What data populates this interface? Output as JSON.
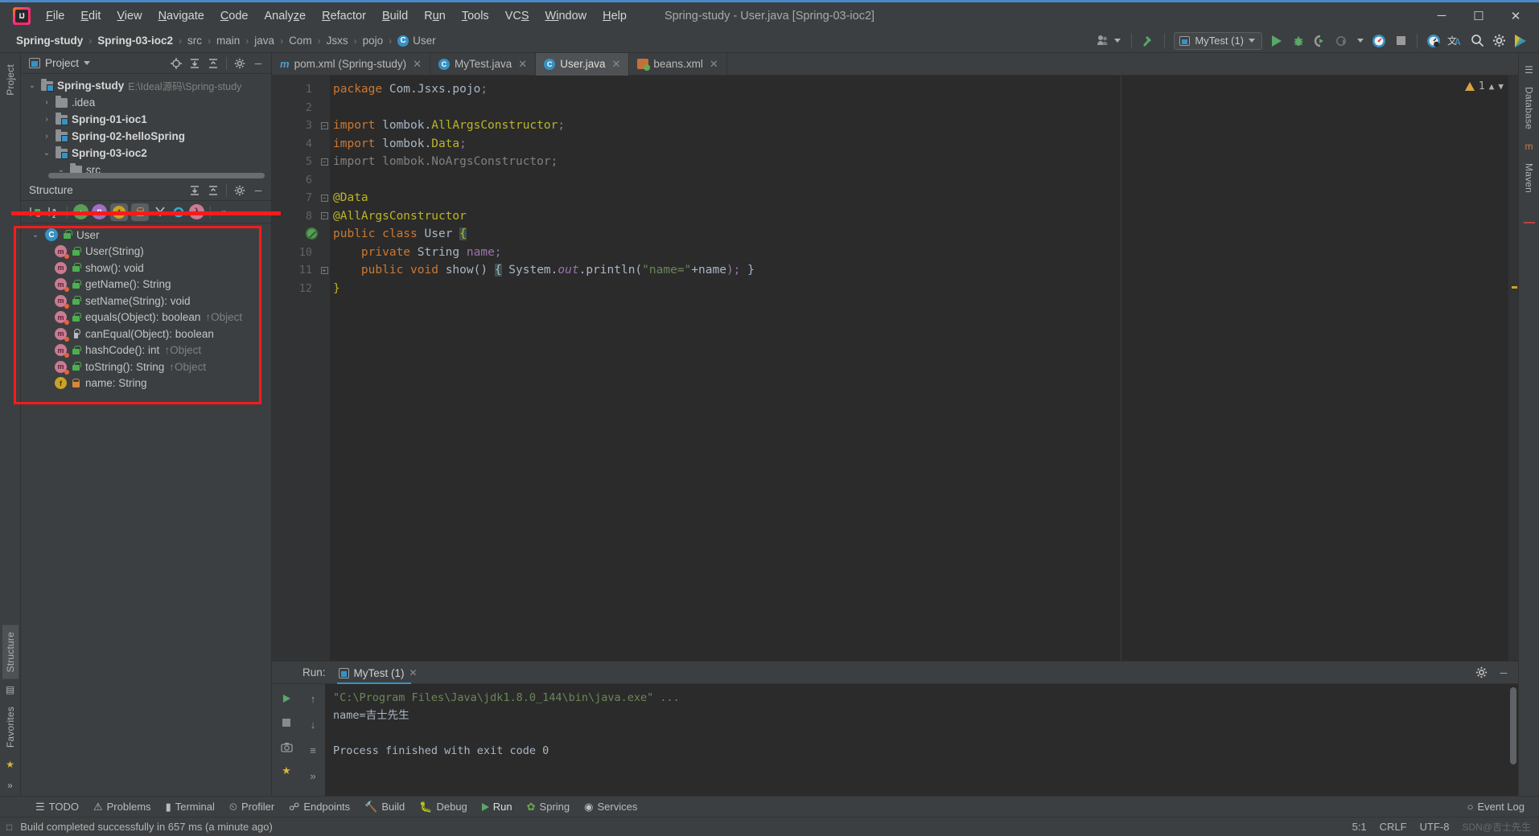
{
  "window": {
    "title": "Spring-study - User.java [Spring-03-ioc2]",
    "logo": "intellij-idea-logo",
    "controls": {
      "minimize": "—",
      "maximize": "☐",
      "close": "✕"
    }
  },
  "menubar": {
    "items": [
      "File",
      "Edit",
      "View",
      "Navigate",
      "Code",
      "Analyze",
      "Refactor",
      "Build",
      "Run",
      "Tools",
      "VCS",
      "Window",
      "Help"
    ]
  },
  "breadcrumb": {
    "items": [
      {
        "label": "Spring-study",
        "bold": true
      },
      {
        "label": "Spring-03-ioc2",
        "bold": true
      },
      {
        "label": "src",
        "bold": false
      },
      {
        "label": "main",
        "bold": false
      },
      {
        "label": "java",
        "bold": false
      },
      {
        "label": "Com",
        "bold": false
      },
      {
        "label": "Jsxs",
        "bold": false
      },
      {
        "label": "pojo",
        "bold": false
      },
      {
        "label": "User",
        "bold": false,
        "icon": "class-badge"
      }
    ],
    "separator": "›"
  },
  "toolbar": {
    "account_icon": "user-account-icon",
    "build_icon": "hammer-icon",
    "run_config": {
      "label": "MyTest (1)",
      "icon": "run-config-icon",
      "caret": "▾"
    },
    "run_icon": "run-play-icon",
    "debug_icon": "debug-bug-icon",
    "run_coverage_icon": "run-with-coverage-icon",
    "profiler_icon": "profiler-icon",
    "stop_icon": "stop-icon",
    "updates_icon": "check-updates-icon",
    "translate_icon": "translate-icon",
    "search_icon": "search-everywhere-icon",
    "settings_icon": "settings-gear-icon",
    "ide_icon": "ide-feature-icon"
  },
  "left_strip": {
    "tabs": [
      "Project",
      "Structure",
      "Favorites"
    ],
    "more": "»"
  },
  "right_strip": {
    "tabs": [
      "Database",
      "Maven"
    ]
  },
  "project_panel": {
    "title": "Project",
    "title_caret": "▾",
    "icon": "project-view-icon",
    "tools": [
      "locate-icon",
      "expand-all-icon",
      "collapse-all-icon",
      "settings-gear-icon",
      "hide-icon"
    ],
    "tree": [
      {
        "label": "Spring-study",
        "path": "E:\\Ideal源码\\Spring-study",
        "indent": 0,
        "arrow": "⌄",
        "bold": true,
        "module": true
      },
      {
        "label": ".idea",
        "path": "",
        "indent": 1,
        "arrow": "›",
        "bold": false,
        "module": false
      },
      {
        "label": "Spring-01-ioc1",
        "path": "",
        "indent": 1,
        "arrow": "›",
        "bold": true,
        "module": true
      },
      {
        "label": "Spring-02-helloSpring",
        "path": "",
        "indent": 1,
        "arrow": "›",
        "bold": true,
        "module": true
      },
      {
        "label": "Spring-03-ioc2",
        "path": "",
        "indent": 1,
        "arrow": "⌄",
        "bold": true,
        "module": true
      },
      {
        "label": "src",
        "path": "",
        "indent": 2,
        "arrow": "⌄",
        "bold": false,
        "module": false
      }
    ]
  },
  "structure_panel": {
    "title": "Structure",
    "tools": [
      "expand-all-icon",
      "collapse-all-icon",
      "settings-gear-icon",
      "hide-icon"
    ],
    "filter_icons": [
      "sort-by-visibility-icon",
      "sort-alphabetically-icon",
      "show-inherited-icon",
      "show-non-public-icon",
      "show-fields-icon",
      "show-properties-icon",
      "show-anonymous-icon",
      "group-icon",
      "lambda-icon"
    ],
    "tree": [
      {
        "label": "User",
        "kind": "class",
        "vis": "pub",
        "indent": 0,
        "arrow": "⌄",
        "sup": ""
      },
      {
        "label": "User(String)",
        "kind": "ctor",
        "vis": "pub",
        "indent": 1,
        "arrow": "",
        "sup": ""
      },
      {
        "label": "show(): void",
        "kind": "method",
        "vis": "pub",
        "indent": 1,
        "arrow": "",
        "sup": ""
      },
      {
        "label": "getName(): String",
        "kind": "ctor",
        "vis": "pub",
        "indent": 1,
        "arrow": "",
        "sup": ""
      },
      {
        "label": "setName(String): void",
        "kind": "ctor",
        "vis": "pub",
        "indent": 1,
        "arrow": "",
        "sup": ""
      },
      {
        "label": "equals(Object): boolean",
        "kind": "ctor",
        "vis": "pub",
        "indent": 1,
        "arrow": "",
        "sup": "↑Object"
      },
      {
        "label": "canEqual(Object): boolean",
        "kind": "ctor",
        "vis": "pkg",
        "indent": 1,
        "arrow": "",
        "sup": ""
      },
      {
        "label": "hashCode(): int",
        "kind": "ctor",
        "vis": "pub",
        "indent": 1,
        "arrow": "",
        "sup": "↑Object"
      },
      {
        "label": "toString(): String",
        "kind": "ctor",
        "vis": "pub",
        "indent": 1,
        "arrow": "",
        "sup": "↑Object"
      },
      {
        "label": "name: String",
        "kind": "field",
        "vis": "priv",
        "indent": 1,
        "arrow": "",
        "sup": ""
      }
    ],
    "annotation_color": "#f81b1b"
  },
  "editor": {
    "tabs": [
      {
        "label": "pom.xml (Spring-study)",
        "icon": "maven-icon",
        "active": false,
        "close": "✕"
      },
      {
        "label": "MyTest.java",
        "icon": "class-icon",
        "active": false,
        "close": "✕"
      },
      {
        "label": "User.java",
        "icon": "class-icon",
        "active": true,
        "close": "✕"
      },
      {
        "label": "beans.xml",
        "icon": "spring-xml-icon",
        "active": false,
        "close": "✕"
      }
    ],
    "line_numbers": [
      "1",
      "2",
      "3",
      "4",
      "5",
      "6",
      "7",
      "8",
      "9",
      "10",
      "11",
      "12"
    ],
    "lines": [
      {
        "n": 1,
        "tokens": [
          {
            "t": "package ",
            "c": "kw"
          },
          {
            "t": "Com.Jsxs.pojo",
            "c": "plain"
          },
          {
            "t": ";",
            "c": "fld"
          }
        ]
      },
      {
        "n": 2,
        "tokens": []
      },
      {
        "n": 3,
        "tokens": [
          {
            "t": "import ",
            "c": "kw"
          },
          {
            "t": "lombok.",
            "c": "plain"
          },
          {
            "t": "AllArgsConstructor",
            "c": "anno"
          },
          {
            "t": ";",
            "c": "fld"
          }
        ]
      },
      {
        "n": 4,
        "tokens": [
          {
            "t": "import ",
            "c": "kw"
          },
          {
            "t": "lombok.",
            "c": "plain"
          },
          {
            "t": "Data",
            "c": "anno"
          },
          {
            "t": ";",
            "c": "fld"
          }
        ]
      },
      {
        "n": 5,
        "tokens": [
          {
            "t": "import lombok.NoArgsConstructor;",
            "c": "gray"
          }
        ]
      },
      {
        "n": 6,
        "tokens": []
      },
      {
        "n": 7,
        "tokens": [
          {
            "t": "@Data",
            "c": "anno"
          }
        ]
      },
      {
        "n": 8,
        "tokens": [
          {
            "t": "@AllArgsConstructor",
            "c": "anno"
          }
        ]
      },
      {
        "n": 9,
        "tokens": [
          {
            "t": "public class ",
            "c": "kw"
          },
          {
            "t": "User ",
            "c": "cls"
          },
          {
            "t": "{",
            "c": "brace"
          }
        ]
      },
      {
        "n": 10,
        "tokens": [
          {
            "t": "    private ",
            "c": "kw"
          },
          {
            "t": "String ",
            "c": "cls"
          },
          {
            "t": "name",
            "c": "fld"
          },
          {
            "t": ";",
            "c": "fld"
          }
        ]
      },
      {
        "n": 11,
        "tokens": [
          {
            "t": "    public void ",
            "c": "kw"
          },
          {
            "t": "show",
            "c": "cls"
          },
          {
            "t": "() ",
            "c": "plain"
          },
          {
            "t": "{",
            "c": "bracehl"
          },
          {
            "t": " System.",
            "c": "plain"
          },
          {
            "t": "out",
            "c": "fldital"
          },
          {
            "t": ".println(",
            "c": "plain"
          },
          {
            "t": "\"name=\"",
            "c": "str"
          },
          {
            "t": "+name",
            "c": "plain"
          },
          {
            "t": "); }",
            "c": "plain"
          }
        ]
      },
      {
        "n": 12,
        "tokens": [
          {
            "t": "}",
            "c": "cls"
          }
        ]
      }
    ],
    "inspection": {
      "count": "1",
      "icon": "warning-triangle-icon",
      "up": "⌃",
      "down": "⌄"
    },
    "run_gutter_marker": "run-test-marker"
  },
  "run_panel": {
    "label": "Run:",
    "tab": {
      "label": "MyTest (1)",
      "icon": "test-run-icon",
      "close": "✕"
    },
    "settings_icon": "settings-gear-icon",
    "hide_icon": "hide-icon",
    "side_buttons": [
      "rerun-icon",
      "scroll-up-icon",
      "stop-icon",
      "scroll-down-icon",
      "print-icon",
      "soft-wrap-icon",
      "camera-icon",
      "pin-icon"
    ],
    "console": [
      {
        "text": "\"C:\\Program Files\\Java\\jdk1.8.0_144\\bin\\java.exe\" ...",
        "kind": "cmd"
      },
      {
        "text": "name=吉士先生",
        "kind": "out"
      },
      {
        "text": "",
        "kind": "out"
      },
      {
        "text": "Process finished with exit code 0",
        "kind": "out"
      }
    ]
  },
  "tool_tabs": {
    "items": [
      {
        "label": "TODO",
        "icon": "todo-icon"
      },
      {
        "label": "Problems",
        "icon": "problems-icon"
      },
      {
        "label": "Terminal",
        "icon": "terminal-icon"
      },
      {
        "label": "Profiler",
        "icon": "profiler-icon"
      },
      {
        "label": "Endpoints",
        "icon": "endpoints-icon"
      },
      {
        "label": "Build",
        "icon": "build-icon"
      },
      {
        "label": "Debug",
        "icon": "debug-icon"
      },
      {
        "label": "Run",
        "icon": "run-icon",
        "active": true
      },
      {
        "label": "Spring",
        "icon": "spring-icon"
      },
      {
        "label": "Services",
        "icon": "services-icon"
      }
    ],
    "event_log": {
      "label": "Event Log",
      "icon": "event-log-icon"
    }
  },
  "status_bar": {
    "message": "Build completed successfully in 657 ms (a minute ago)",
    "icon": "build-status-icon",
    "caret_position": "5:1",
    "line_separator": "CRLF",
    "encoding": "UTF-8",
    "watermark": "SDN@吉士先生"
  },
  "colors": {
    "accent_blue": "#4a88c7",
    "panel_bg": "#3c3f41",
    "editor_bg": "#2b2b2b",
    "annotation_red": "#f81b1b",
    "keyword_orange": "#cc7832",
    "annotation_yellow": "#bbb529",
    "string_green": "#6a8759",
    "field_purple": "#9876aa"
  }
}
